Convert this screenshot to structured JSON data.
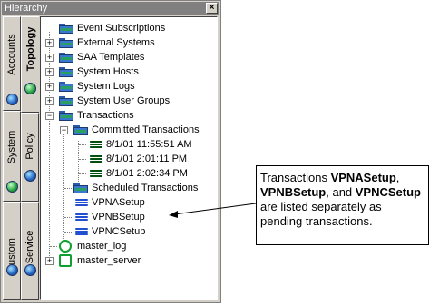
{
  "window": {
    "title": "Hierarchy",
    "close_glyph": "×"
  },
  "tabs": {
    "accounts": "Accounts",
    "topology": "Topology",
    "system": "System",
    "policy": "Policy",
    "custom": "Custom",
    "service": "Service"
  },
  "tree": {
    "items": [
      {
        "label": "Event Subscriptions",
        "expander": ""
      },
      {
        "label": "External Systems",
        "expander": "+"
      },
      {
        "label": "SAA Templates",
        "expander": "+"
      },
      {
        "label": "System Hosts",
        "expander": "+"
      },
      {
        "label": "System Logs",
        "expander": "+"
      },
      {
        "label": "System User Groups",
        "expander": "+"
      },
      {
        "label": "Transactions",
        "expander": "−"
      },
      {
        "label": "Committed Transactions",
        "expander": "−"
      },
      {
        "label": "8/1/01 11:55:51 AM"
      },
      {
        "label": "8/1/01 2:01:11 PM"
      },
      {
        "label": "8/1/01 2:02:34 PM"
      },
      {
        "label": "Scheduled Transactions"
      },
      {
        "label": "VPNASetup"
      },
      {
        "label": "VPNBSetup"
      },
      {
        "label": "VPNCSetup"
      },
      {
        "label": "master_log"
      },
      {
        "label": "master_server",
        "expander": "+"
      }
    ]
  },
  "callout": {
    "p1": "Transactions ",
    "b1": "VPNASetup",
    "p2": ", ",
    "b2": "VPNBSetup",
    "p3": ", and ",
    "b3": "VPNCSetup",
    "p4": " are listed separately as pending transactions."
  },
  "colors": {
    "folder": "#3a78d0",
    "transaction_green": "#10a030",
    "transaction_blue": "#2050d0"
  }
}
